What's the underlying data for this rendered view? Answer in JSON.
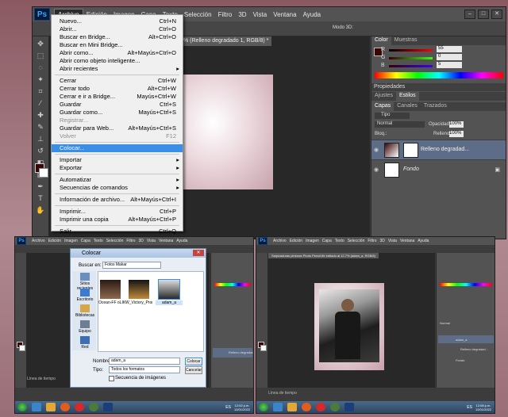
{
  "main_window": {
    "menu": [
      "Archivo",
      "Edición",
      "Imagen",
      "Capa",
      "Texto",
      "Selección",
      "Filtro",
      "3D",
      "Vista",
      "Ventana",
      "Ayuda"
    ],
    "doc_tab": "% (Relleno degradado 1, RGB/8) *",
    "mode_label": "Modo 3D:",
    "color_panel": {
      "tabs": [
        "Color",
        "Muestras"
      ],
      "r": "55",
      "g": "0",
      "b": "5"
    },
    "adjust_tabs": [
      "Ajustes",
      "Estilos"
    ],
    "props_title": "Propiedades",
    "layers_tabs": [
      "Capas",
      "Canales",
      "Trazados"
    ],
    "kind_label": "Tipo",
    "blend_mode": "Normal",
    "opacity_label": "Opacidad:",
    "opacity_value": "100%",
    "lock_label": "Bloq.:",
    "fill_label": "Relleno:",
    "fill_value": "100%",
    "layers": [
      "Relleno degradad...",
      "Fondo"
    ]
  },
  "file_menu": [
    {
      "label": "Nuevo...",
      "shortcut": "Ctrl+N"
    },
    {
      "label": "Abrir...",
      "shortcut": "Ctrl+O"
    },
    {
      "label": "Buscar en Bridge...",
      "shortcut": "Alt+Ctrl+O"
    },
    {
      "label": "Buscar en Mini Bridge...",
      "shortcut": ""
    },
    {
      "label": "Abrir como...",
      "shortcut": "Alt+Mayús+Ctrl+O"
    },
    {
      "label": "Abrir como objeto inteligente...",
      "shortcut": ""
    },
    {
      "label": "Abrir recientes",
      "shortcut": ""
    },
    {
      "label": "Cerrar",
      "shortcut": "Ctrl+W"
    },
    {
      "label": "Cerrar todo",
      "shortcut": "Alt+Ctrl+W"
    },
    {
      "label": "Cerrar e ir a Bridge...",
      "shortcut": "Mayús+Ctrl+W"
    },
    {
      "label": "Guardar",
      "shortcut": "Ctrl+S"
    },
    {
      "label": "Guardar como...",
      "shortcut": "Mayús+Ctrl+S"
    },
    {
      "label": "Registrar...",
      "shortcut": ""
    },
    {
      "label": "Guardar para Web...",
      "shortcut": "Alt+Mayús+Ctrl+S"
    },
    {
      "label": "Volver",
      "shortcut": "F12"
    },
    {
      "label": "Colocar...",
      "shortcut": ""
    },
    {
      "label": "Importar",
      "shortcut": ""
    },
    {
      "label": "Exportar",
      "shortcut": ""
    },
    {
      "label": "Automatizar",
      "shortcut": ""
    },
    {
      "label": "Secuencias de comandos",
      "shortcut": ""
    },
    {
      "label": "Información de archivo...",
      "shortcut": "Alt+Mayús+Ctrl+I"
    },
    {
      "label": "Imprimir...",
      "shortcut": "Ctrl+P"
    },
    {
      "label": "Imprimir una copia",
      "shortcut": "Alt+Mayús+Ctrl+P"
    },
    {
      "label": "Salir",
      "shortcut": "Ctrl+Q"
    }
  ],
  "status_line": "Línea de tiempo",
  "small_menu": [
    "Archivo",
    "Edición",
    "Imagen",
    "Capa",
    "Texto",
    "Selección",
    "Filtro",
    "3D",
    "Vista",
    "Ventana",
    "Ayuda"
  ],
  "dialog": {
    "title": "Colocar",
    "buscar_label": "Buscar en:",
    "folder": "Fotos Makar",
    "places": [
      "Sitios recientes",
      "Escritorio",
      "Bibliotecas",
      "Equipo",
      "Red"
    ],
    "files": [
      "Ocean-FF oLIKE...",
      "W_Victory_Prom...",
      "adam_a"
    ],
    "name_label": "Nombre:",
    "name_value": "adam_a",
    "type_label": "Tipo:",
    "type_value": "Todos los formatos",
    "place_button": "Colocar",
    "cancel_button": "Cancelar",
    "sequence_label": "Secuencia de imágenes"
  },
  "right_window": {
    "doc_tab": "Salpicaduras pinturas Photo Pencil.tfe editado al 12.7% (adam_a, RGB/8)",
    "layers": [
      "adam_a",
      "Relleno degradad...",
      "Fondo"
    ],
    "blend_mode": "Normal"
  },
  "taskbar": {
    "lang": "ES",
    "time_left": "12:02 p.m.",
    "date_left": "12/01/2022",
    "time_right": "12:08 p.m.",
    "date_right": "12/01/2022"
  },
  "colors": {
    "accent": "#3a8ee6",
    "fg_swatch": "#3a0606",
    "menu_bg": "#f0f0f0"
  }
}
